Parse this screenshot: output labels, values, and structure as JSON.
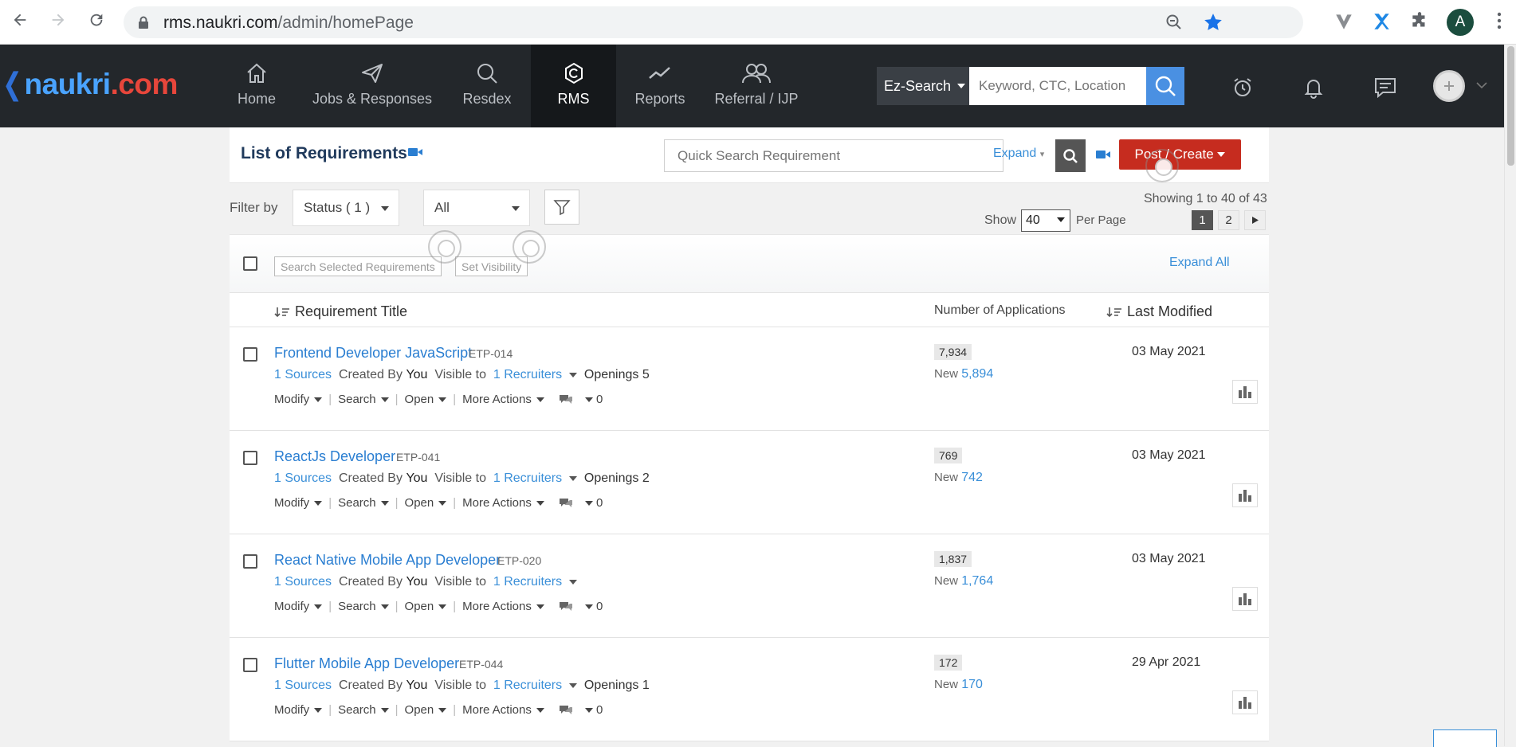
{
  "browser": {
    "url_host": "rms.naukri.com",
    "url_path": "/admin/homePage",
    "profile_initial": "A"
  },
  "header": {
    "logo_prefix": "naukri",
    "logo_suffix": ".com",
    "nav": [
      {
        "label": "Home",
        "icon": "home-icon"
      },
      {
        "label": "Jobs & Responses",
        "icon": "paper-plane-icon"
      },
      {
        "label": "Resdex",
        "icon": "search-icon"
      },
      {
        "label": "RMS",
        "icon": "rms-icon",
        "active": true
      },
      {
        "label": "Reports",
        "icon": "trend-line-icon"
      },
      {
        "label": "Referral / IJP",
        "icon": "users-icon"
      }
    ],
    "ez_search_label": "Ez-Search",
    "ez_search_placeholder": "Keyword, CTC, Location"
  },
  "panel": {
    "title": "List of Requirements",
    "quick_search_placeholder": "Quick Search Requirement",
    "expand_label": "Expand",
    "post_create_label": "Post / Create"
  },
  "filters": {
    "filter_by_label": "Filter by",
    "status_value": "Status ( 1 )",
    "all_value": "All",
    "showing_text": "Showing 1 to 40 of 43",
    "show_label": "Show",
    "per_page_value": "40",
    "per_page_label": "Per Page",
    "pages": [
      "1",
      "2"
    ],
    "current_page": "1"
  },
  "toolbar": {
    "search_selected_label": "Search Selected Requirements",
    "set_visibility_label": "Set Visibility",
    "expand_all_label": "Expand All"
  },
  "columns": {
    "title": "Requirement Title",
    "applications": "Number of Applications",
    "last_modified": "Last Modified"
  },
  "actions": {
    "modify": "Modify",
    "search": "Search",
    "open": "Open",
    "more": "More Actions"
  },
  "requirements": [
    {
      "title": "Frontend Developer JavaScript",
      "code": "ETP-014",
      "sources": "1 Sources",
      "created_by_label": "Created By",
      "created_by": "You",
      "visible_label": "Visible to",
      "recruiters": "1 Recruiters",
      "openings": "Openings 5",
      "comments": "0",
      "applications": "7,934",
      "new_label": "New",
      "new_count": "5,894",
      "modified": "03 May 2021"
    },
    {
      "title": "ReactJs Developer",
      "code": "ETP-041",
      "sources": "1 Sources",
      "created_by_label": "Created By",
      "created_by": "You",
      "visible_label": "Visible to",
      "recruiters": "1 Recruiters",
      "openings": "Openings 2",
      "comments": "0",
      "applications": "769",
      "new_label": "New",
      "new_count": "742",
      "modified": "03 May 2021"
    },
    {
      "title": "React Native Mobile App Developer",
      "code": "ETP-020",
      "sources": "1 Sources",
      "created_by_label": "Created By",
      "created_by": "You",
      "visible_label": "Visible to",
      "recruiters": "1 Recruiters",
      "openings": "",
      "comments": "0",
      "applications": "1,837",
      "new_label": "New",
      "new_count": "1,764",
      "modified": "03 May 2021"
    },
    {
      "title": "Flutter Mobile App Developer",
      "code": "ETP-044",
      "sources": "1 Sources",
      "created_by_label": "Created By",
      "created_by": "You",
      "visible_label": "Visible to",
      "recruiters": "1 Recruiters",
      "openings": "Openings 1",
      "comments": "0",
      "applications": "172",
      "new_label": "New",
      "new_count": "170",
      "modified": "29 Apr 2021"
    }
  ],
  "colors": {
    "header_bg": "#23272b",
    "link": "#2a7ed1",
    "post_button": "#c62c1f",
    "search_button": "#4a90e2"
  }
}
